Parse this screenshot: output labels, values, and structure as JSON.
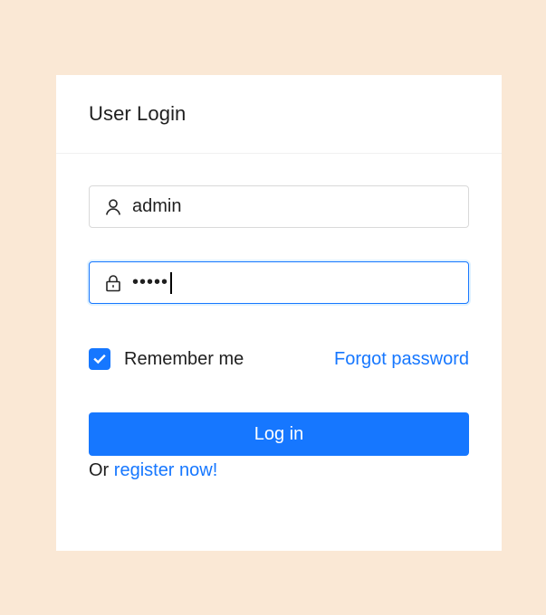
{
  "login": {
    "title": "User Login",
    "username": {
      "icon": "user-icon",
      "value": "admin"
    },
    "password": {
      "icon": "lock-icon",
      "masked_value": "•••••"
    },
    "remember": {
      "checked": true,
      "label": "Remember me"
    },
    "forgot_label": "Forgot password",
    "login_button_label": "Log in",
    "register": {
      "prefix": "Or",
      "link_label": "register now!"
    }
  },
  "colors": {
    "background": "#fae8d5",
    "primary": "#1677ff",
    "card": "#ffffff",
    "border": "#d9d9d9"
  }
}
